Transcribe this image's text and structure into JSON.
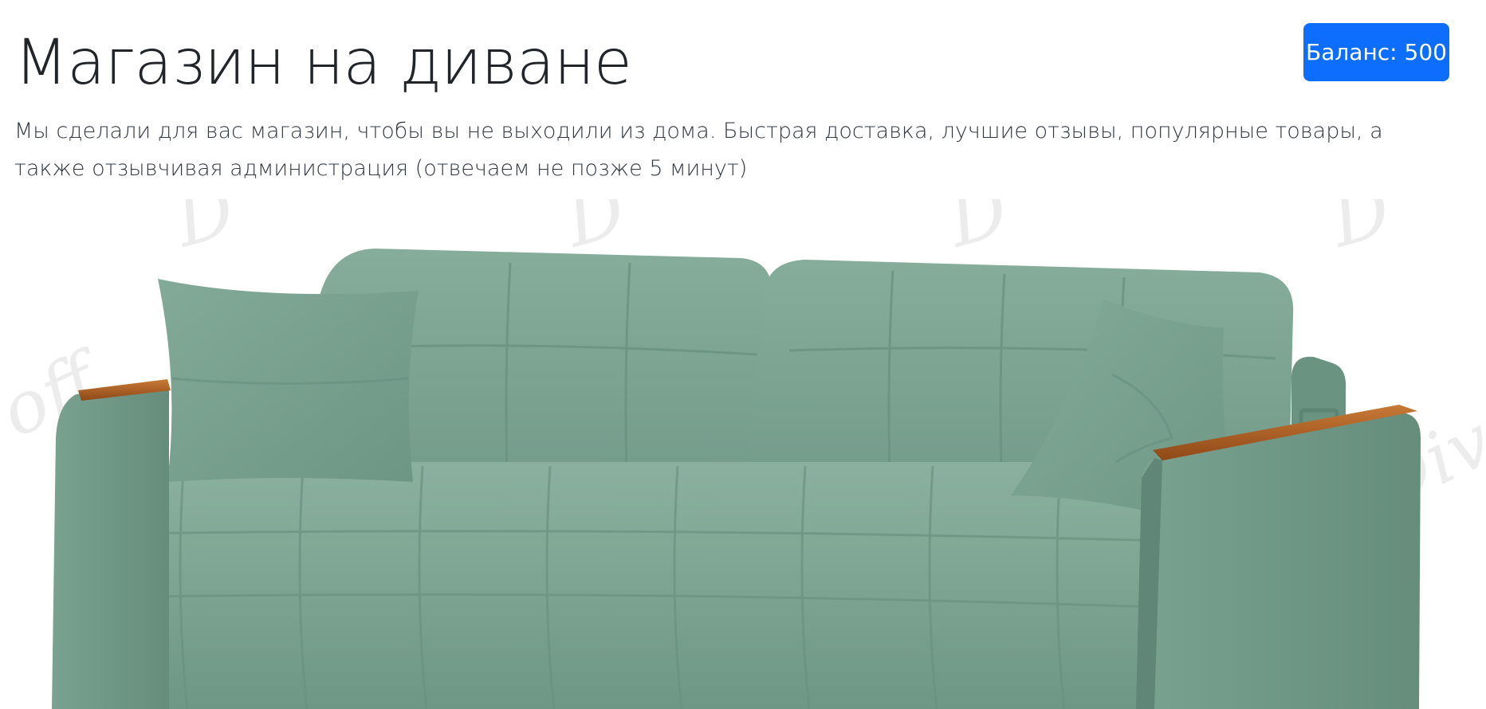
{
  "header": {
    "title": "Магазин на диване",
    "balance_label": "Баланс: 500"
  },
  "intro": {
    "text": "Мы сделали для вас магазин, чтобы вы не выходили из дома. Быстрая доставка, лучшие отзывы, популярные товары, а также отзывчивая администрация (отвечаем не позже 5 минут)"
  },
  "colors": {
    "primary": "#0d6efd",
    "sofa_fabric": "#78a08e",
    "armrest_wood": "#a85a22"
  }
}
